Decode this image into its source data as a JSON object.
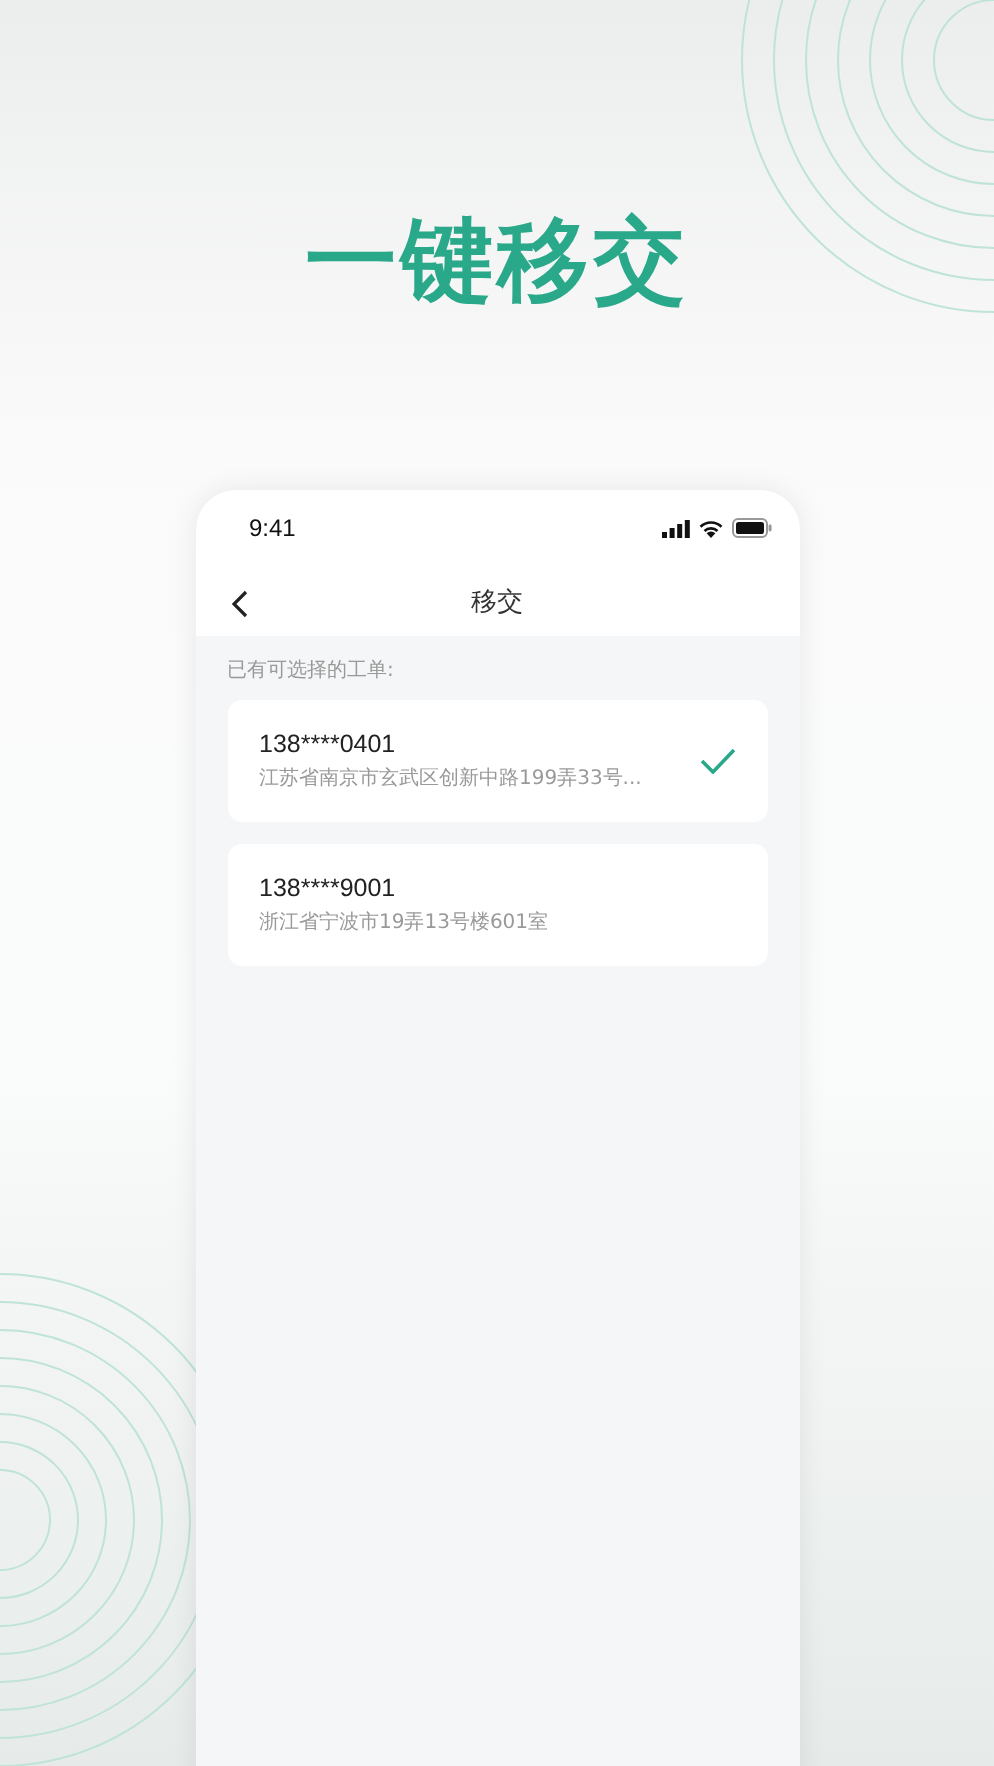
{
  "headline": "一键移交",
  "status_bar": {
    "time": "9:41"
  },
  "nav_bar": {
    "title": "移交"
  },
  "section_label": "已有可选择的工单:",
  "orders": [
    {
      "phone": "138****0401",
      "address": "江苏省南京市玄武区创新中路199弄33号...",
      "selected": true
    },
    {
      "phone": "138****9001",
      "address": "浙江省宁波市19弄13号楼601室",
      "selected": false
    }
  ]
}
